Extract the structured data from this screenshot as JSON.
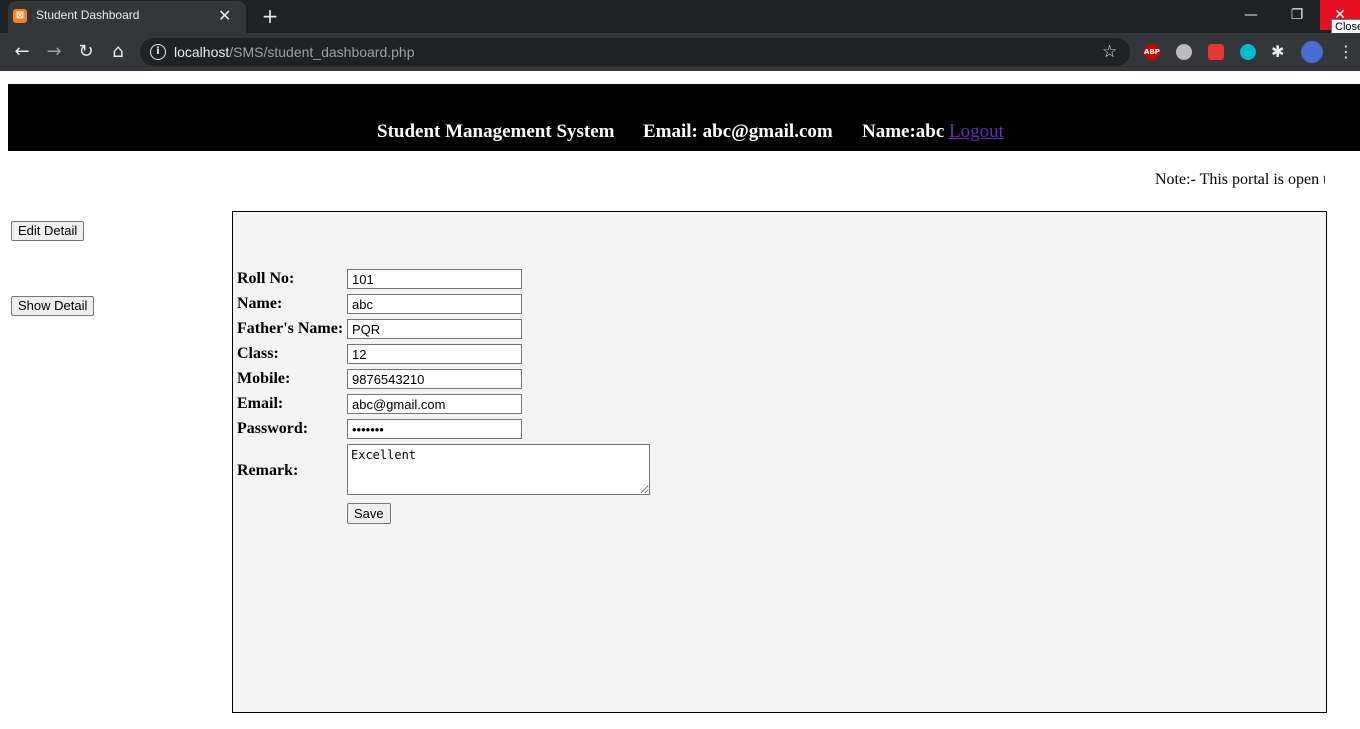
{
  "browser": {
    "tab_title": "Student Dashboard",
    "url_host": "localhost",
    "url_path": "/SMS/student_dashboard.php",
    "close_tooltip": "Close",
    "extensions": [
      "ABP"
    ]
  },
  "header": {
    "title": "Student Management System",
    "email": "Email: abc@gmail.com",
    "name": "Name:abc",
    "logout": "Logout"
  },
  "note": "Note:- This portal is open t",
  "sidebar": {
    "edit_button": "Edit Detail",
    "show_button": "Show Detail"
  },
  "form": {
    "fields": [
      {
        "label": "Roll No:",
        "value": "101"
      },
      {
        "label": "Name:",
        "value": "abc"
      },
      {
        "label": "Father's Name:",
        "value": "PQR"
      },
      {
        "label": "Class:",
        "value": "12"
      },
      {
        "label": "Mobile:",
        "value": "9876543210"
      },
      {
        "label": "Email:",
        "value": "abc@gmail.com"
      },
      {
        "label": "Password:",
        "value": "•••••••"
      }
    ],
    "remark_label": "Remark:",
    "remark_value": "Excellent",
    "save_button": "Save"
  }
}
